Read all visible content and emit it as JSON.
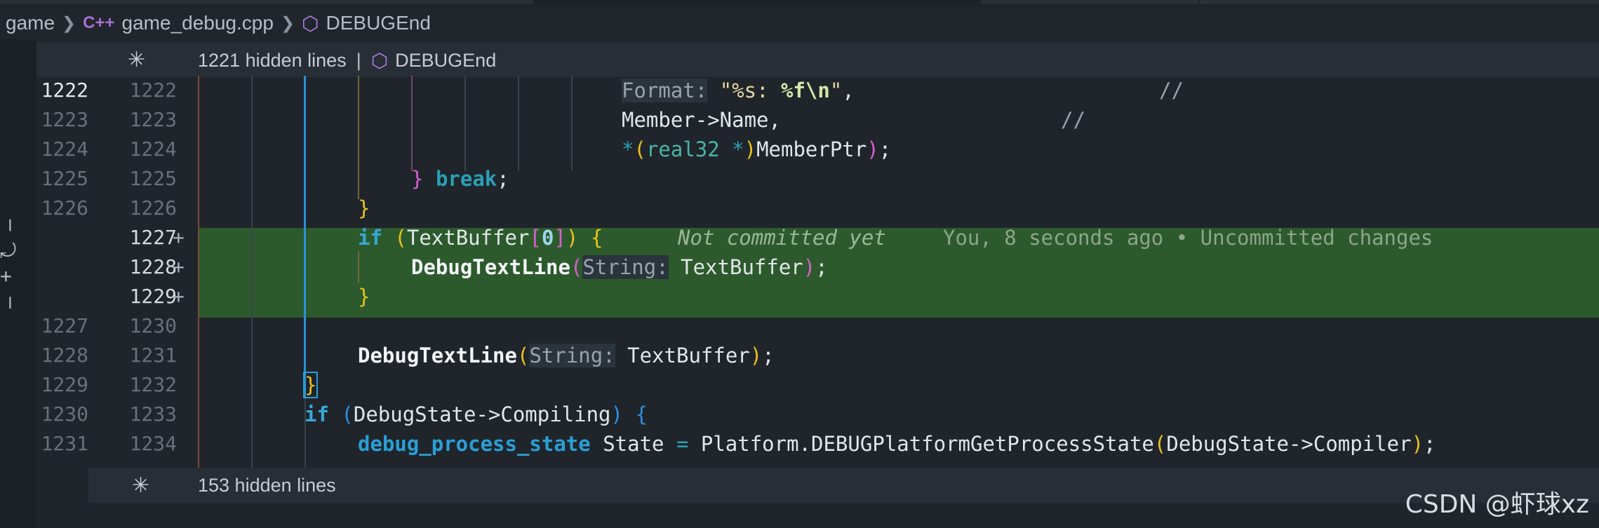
{
  "breadcrumb": {
    "folder": "game",
    "file_icon": "C++",
    "file": "game_debug.cpp",
    "symbol": "DEBUGEnd"
  },
  "fold_top": {
    "hidden": "1221 hidden lines",
    "symbol": "DEBUGEnd"
  },
  "fold_bottom": {
    "hidden": "153 hidden lines"
  },
  "lines": [
    {
      "old": "1222",
      "new": "1222",
      "plus": ""
    },
    {
      "old": "1223",
      "new": "1223",
      "plus": ""
    },
    {
      "old": "1224",
      "new": "1224",
      "plus": ""
    },
    {
      "old": "1225",
      "new": "1225",
      "plus": ""
    },
    {
      "old": "1226",
      "new": "1226",
      "plus": ""
    },
    {
      "old": "",
      "new": "1227",
      "plus": "+"
    },
    {
      "old": "",
      "new": "1228",
      "plus": "+"
    },
    {
      "old": "",
      "new": "1229",
      "plus": "+"
    },
    {
      "old": "1227",
      "new": "1230",
      "plus": ""
    },
    {
      "old": "1228",
      "new": "1231",
      "plus": ""
    },
    {
      "old": "1229",
      "new": "1232",
      "plus": ""
    },
    {
      "old": "1230",
      "new": "1233",
      "plus": ""
    },
    {
      "old": "1231",
      "new": "1234",
      "plus": ""
    }
  ],
  "code": {
    "l1": {
      "hint": "Format:",
      "str_open": "\"%s: ",
      "esc": "%f\\n",
      "str_close": "\"",
      "tail": ",",
      "comment": "//"
    },
    "l2": {
      "text": "Member->Name,",
      "comment": "//"
    },
    "l3": {
      "star1": "*",
      "open": "(",
      "type": "real32 ",
      "star2": "*",
      "close": ")",
      "rest": "MemberPtr",
      "close2": ")",
      "semi": ";"
    },
    "l4": {
      "brace": "}",
      "kw": "break",
      "semi": ";"
    },
    "l5": {
      "brace": "}"
    },
    "l6": {
      "kw": "if",
      "open": "(",
      "name": "TextBuffer",
      "ob": "[",
      "num": "0",
      "cb": "]",
      "close": ")",
      "brace": "{",
      "blame": "Not committed yet",
      "blame2": "You, 8 seconds ago • Uncommitted changes"
    },
    "l7": {
      "fn": "DebugTextLine",
      "open": "(",
      "hint": "String:",
      "arg": "TextBuffer",
      "close": ")",
      "semi": ";"
    },
    "l8": {
      "brace": "}"
    },
    "l10": {
      "fn": "DebugTextLine",
      "open": "(",
      "hint": "String:",
      "arg": "TextBuffer",
      "close": ")",
      "semi": ";"
    },
    "l11": {
      "brace": "}"
    },
    "l12": {
      "kw": "if",
      "open": "(",
      "expr": "DebugState->Compiling",
      "close": ")",
      "brace": "{"
    },
    "l13": {
      "type": "debug_process_state",
      "var": " State ",
      "eq": "=",
      "call": " Platform.DEBUGPlatformGetProcessState",
      "open": "(",
      "arg": "DebugState->Compiler",
      "close": ")",
      "semi": ";"
    }
  },
  "watermark": "CSDN @虾球xz"
}
